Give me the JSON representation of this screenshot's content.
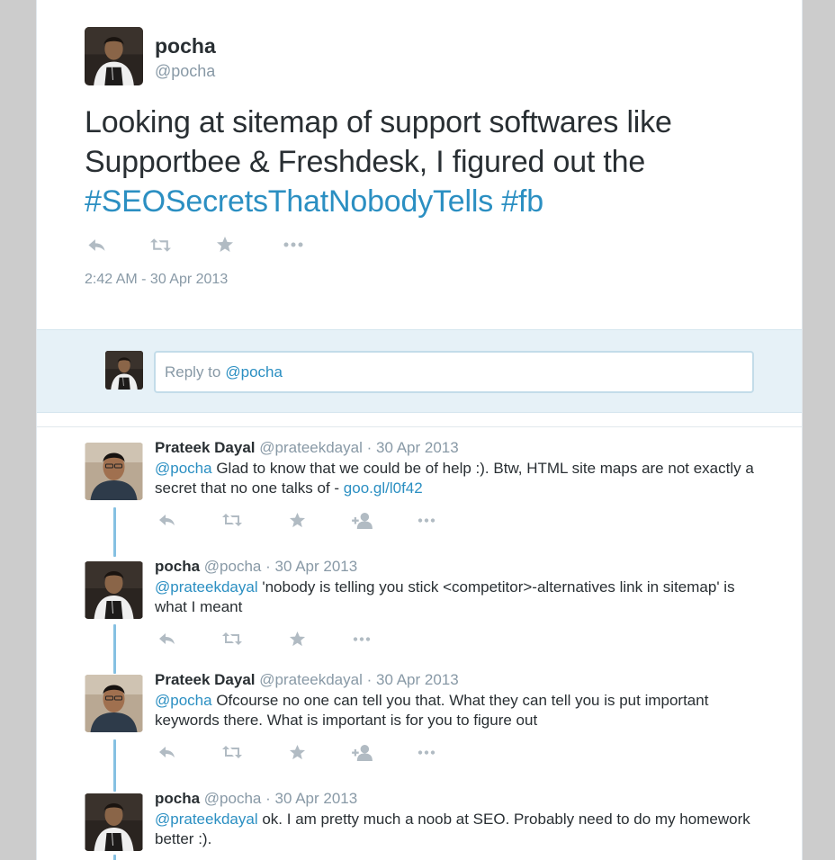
{
  "main_tweet": {
    "name": "pocha",
    "handle": "@pocha",
    "text_plain": "Looking at sitemap of support softwares like Supportbee & Freshdesk, I figured out the",
    "hashtag1": "#SEOSecretsThatNobodyTells",
    "hashtag2": "#fb",
    "timestamp": "2:42 AM - 30 Apr 2013",
    "actions": [
      "reply-icon",
      "retweet-icon",
      "favorite-icon",
      "more-icon"
    ]
  },
  "reply_box": {
    "placeholder_prefix": "Reply to",
    "mention": "@pocha"
  },
  "replies": [
    {
      "name": "Prateek Dayal",
      "handle": "@prateekdayal",
      "date": "· 30 Apr 2013",
      "mention": "@pocha",
      "text": "Glad to know that we could be of help :). Btw, HTML site maps are not exactly a secret that no one talks of -",
      "link": "goo.gl/l0f42",
      "actions": [
        "reply-icon",
        "retweet-icon",
        "favorite-icon",
        "follow-icon",
        "more-icon"
      ]
    },
    {
      "name": "pocha",
      "handle": "@pocha",
      "date": "· 30 Apr 2013",
      "mention": "@prateekdayal",
      "text": "'nobody is telling you stick <competitor>-alternatives link in sitemap' is what I meant",
      "actions": [
        "reply-icon",
        "retweet-icon",
        "favorite-icon",
        "more-icon"
      ]
    },
    {
      "name": "Prateek Dayal",
      "handle": "@prateekdayal",
      "date": "· 30 Apr 2013",
      "mention": "@pocha",
      "text": "Ofcourse no one can tell you that. What they can tell you is put important keywords there. What is important is for you to figure out",
      "actions": [
        "reply-icon",
        "retweet-icon",
        "favorite-icon",
        "follow-icon",
        "more-icon"
      ]
    },
    {
      "name": "pocha",
      "handle": "@pocha",
      "date": "· 30 Apr 2013",
      "mention": "@prateekdayal",
      "text": "ok. I am pretty much a noob at SEO. Probably need to do my homework better :).",
      "actions": []
    }
  ],
  "colors": {
    "link": "#2b8fc2",
    "muted": "#8899a6",
    "icon": "#b1bbc3",
    "reply_bg": "#e6f1f7",
    "thread_line": "#85c0e2"
  }
}
